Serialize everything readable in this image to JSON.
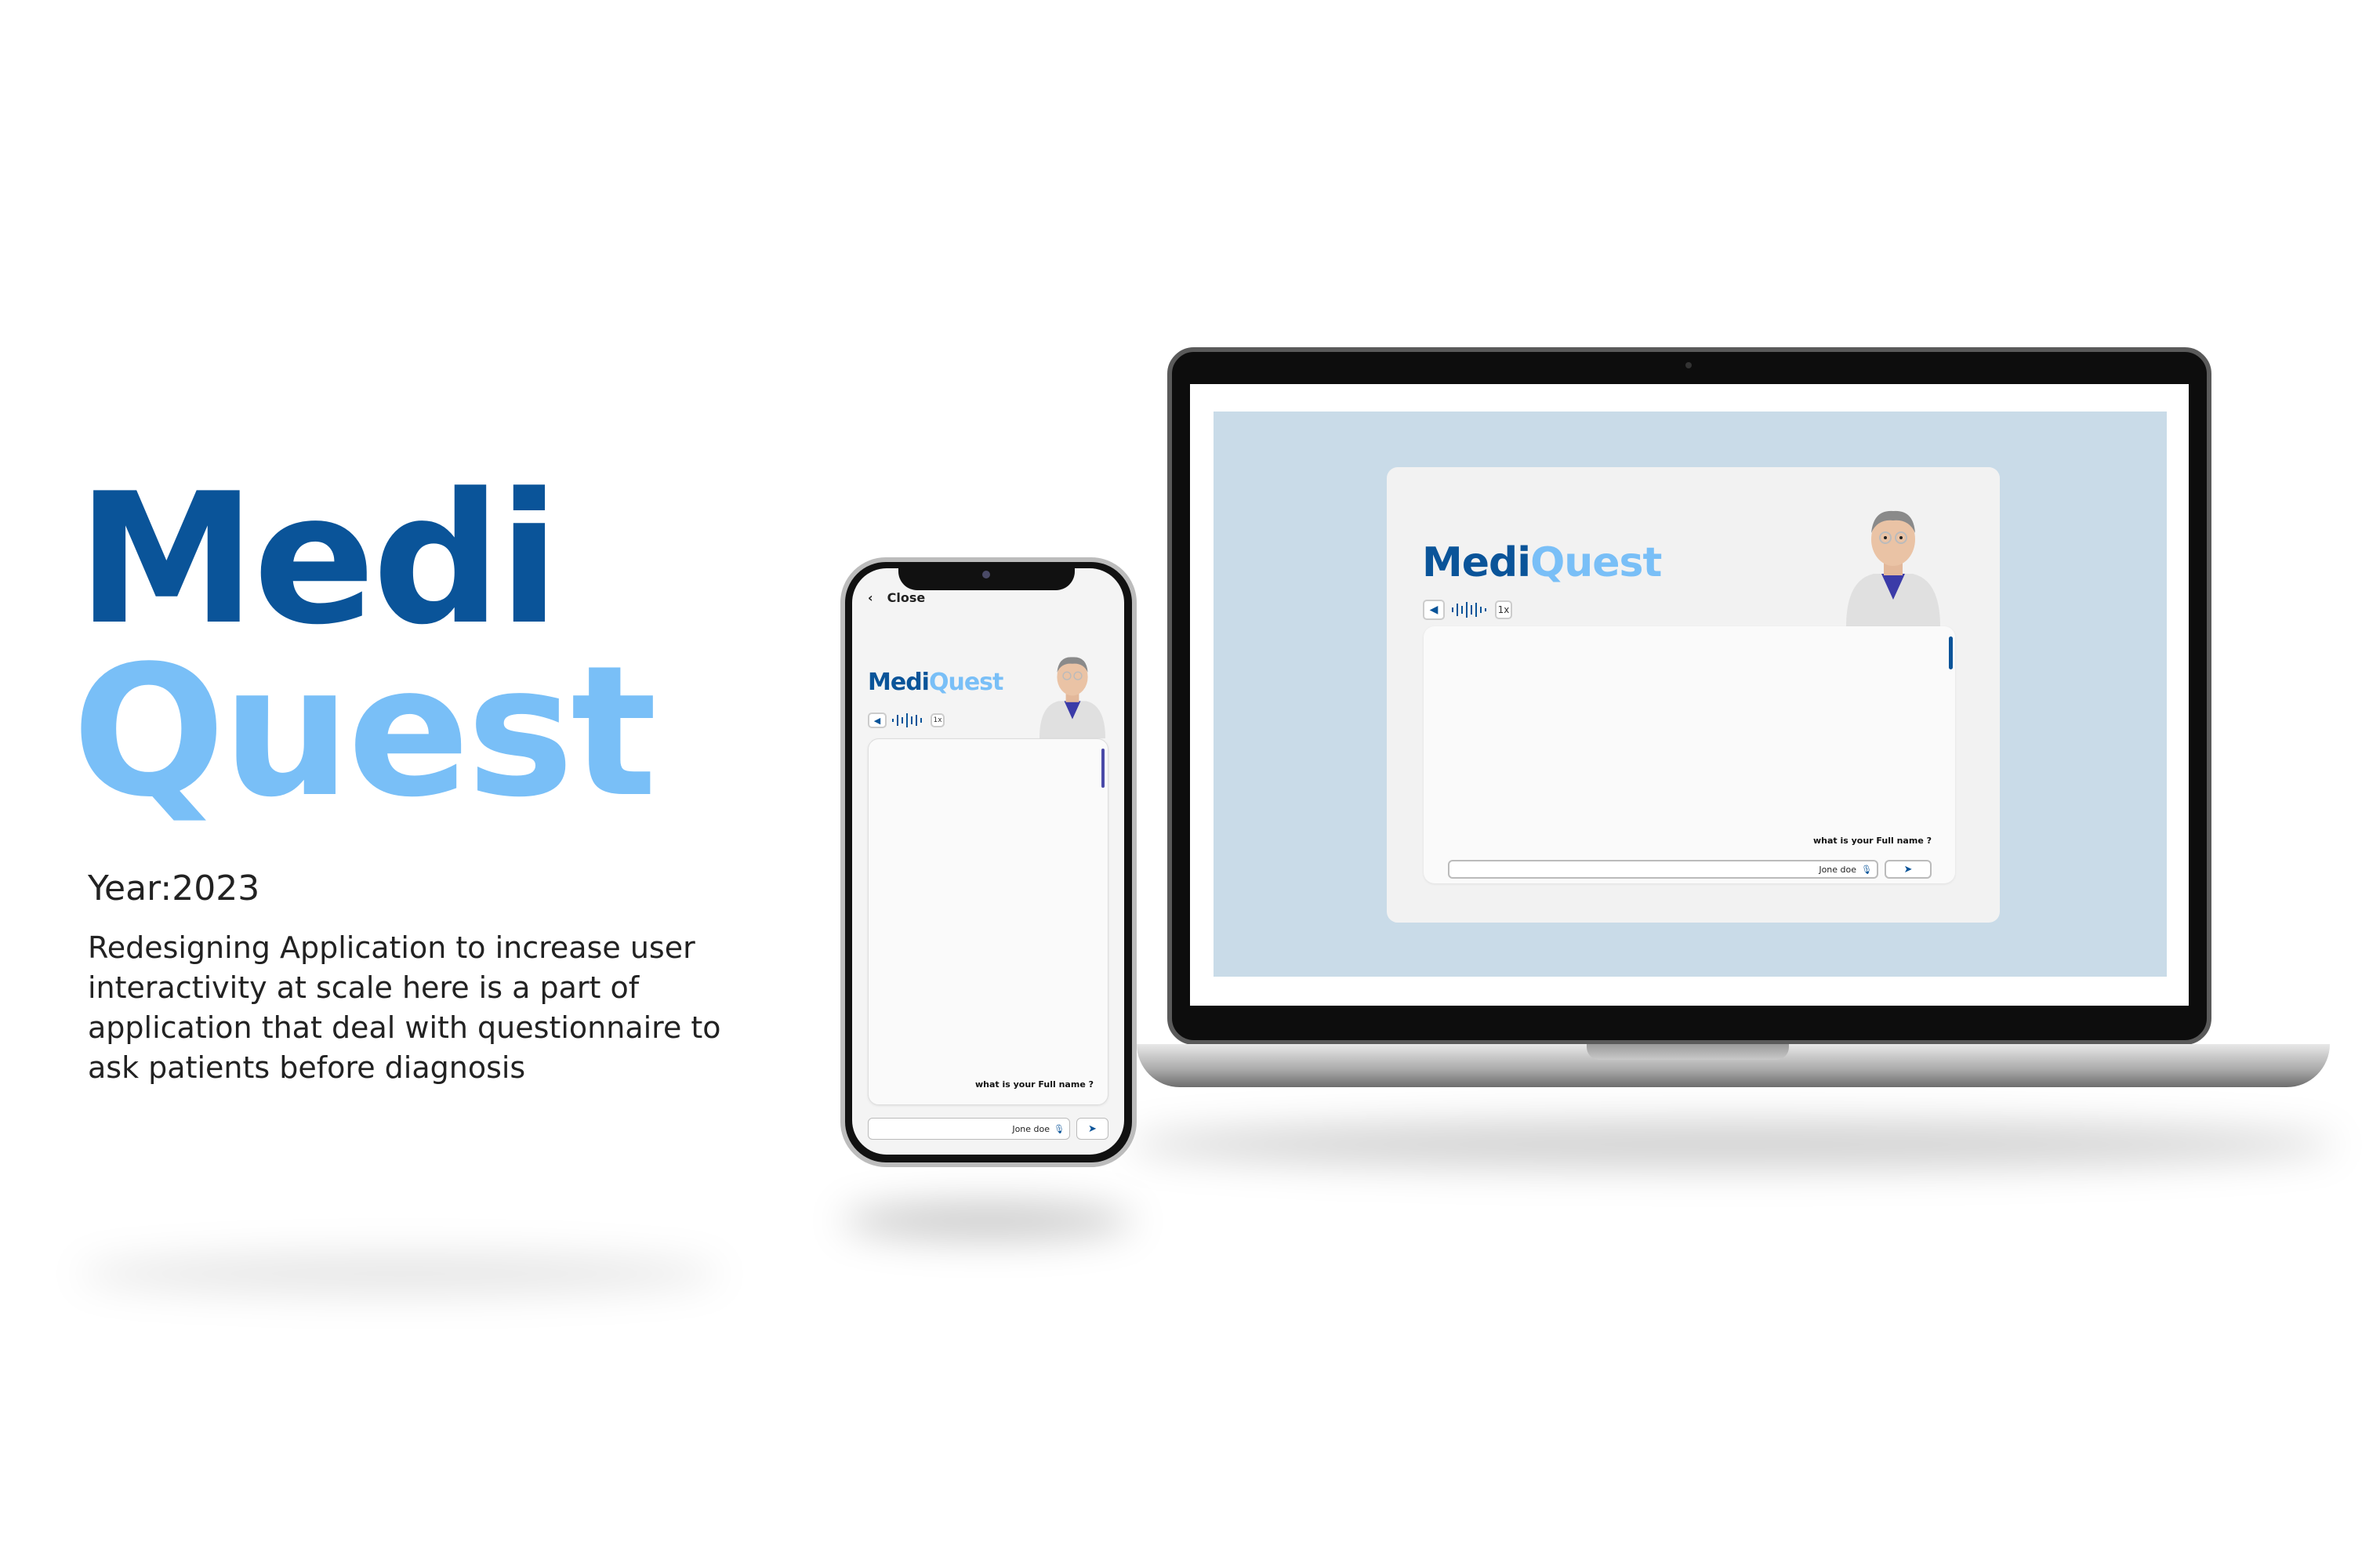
{
  "hero": {
    "title_part1": "Medi",
    "title_part2": "Quest",
    "year": "Year:2023",
    "description": "Redesigning Application to increase user interactivity at scale here is a part of application that deal with questionnaire to ask patients before diagnosis"
  },
  "app": {
    "logo_part1": "Medi",
    "logo_part2": "Quest",
    "close_label": "Close",
    "speed_label": "1x",
    "question": "what is your Full name ?",
    "input_value": "Jone doe"
  },
  "colors": {
    "brand_dark": "#0a5499",
    "brand_light": "#79bff7",
    "laptop_bg": "#c9dbe8"
  },
  "icons": [
    "chevron-left-icon",
    "speaker-icon",
    "waveform-icon",
    "microphone-icon",
    "send-icon",
    "doctor-avatar"
  ]
}
